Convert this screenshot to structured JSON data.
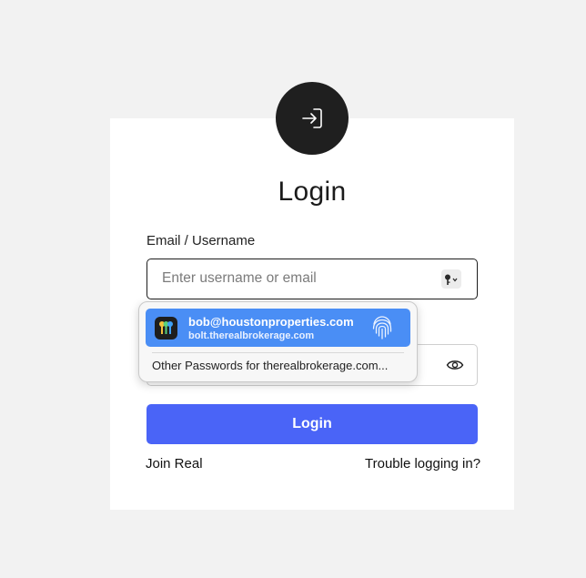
{
  "header": {
    "title": "Login"
  },
  "form": {
    "email_label": "Email / Username",
    "email_placeholder": "Enter username or email",
    "submit_label": "Login"
  },
  "links": {
    "join": "Join Real",
    "trouble": "Trouble logging in?"
  },
  "password_autofill": {
    "account": "bob@houstonproperties.com",
    "site": "bolt.therealbrokerage.com",
    "other_passwords": "Other Passwords for therealbrokerage.com..."
  },
  "icons": {
    "badge": "login-arrow-icon",
    "key": "key-icon",
    "eye": "eye-icon",
    "fingerprint": "fingerprint-icon",
    "app": "passwords-app-icon"
  },
  "colors": {
    "primary": "#4a64f7",
    "suggestion_highlight": "#4a8ef5",
    "badge": "#1f1f1f",
    "background": "#f2f2f2"
  }
}
